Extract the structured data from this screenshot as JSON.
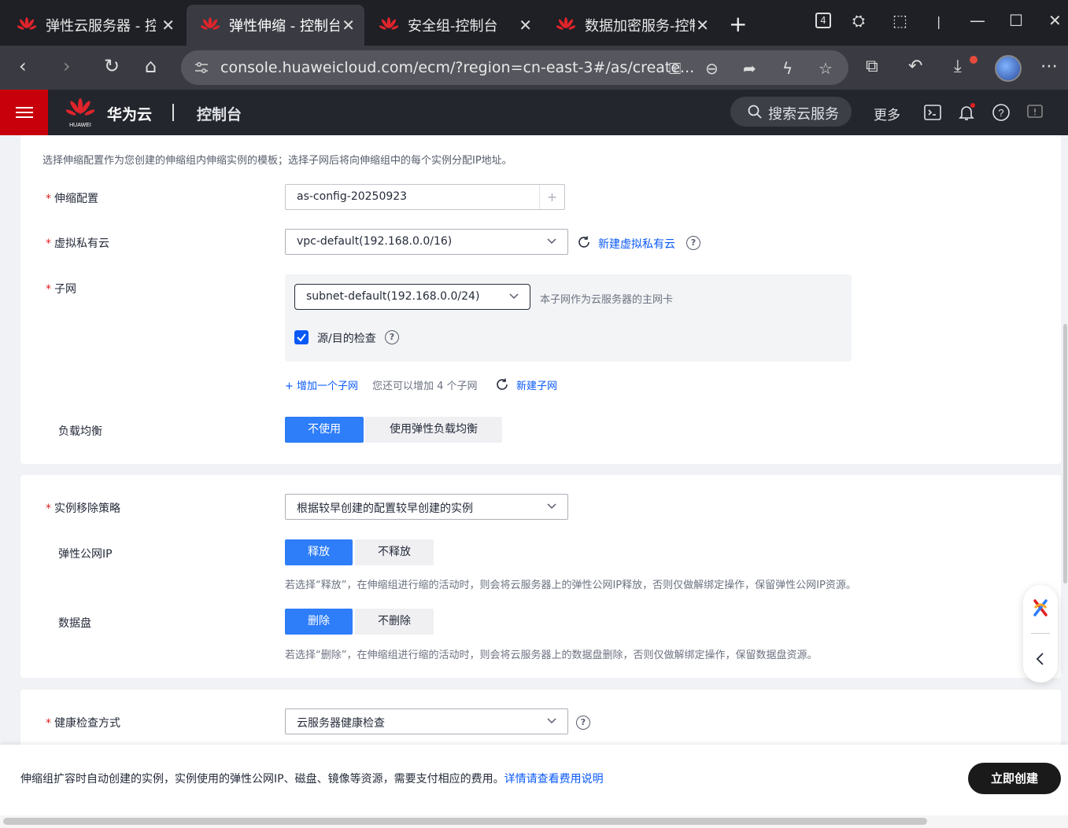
{
  "browser": {
    "tabs": [
      {
        "title": "弹性云服务器 - 控制台",
        "active": false
      },
      {
        "title": "弹性伸缩 - 控制台",
        "active": true
      },
      {
        "title": "安全组-控制台",
        "active": false
      },
      {
        "title": "数据加密服务-控制台",
        "active": false
      }
    ],
    "tab_count_badge": "4",
    "url": "console.huaweicloud.com/ecm/?region=cn-east-3#/as/create..."
  },
  "console_header": {
    "brand": "华为云",
    "logo_text": "HUAWEI",
    "console_label": "控制台",
    "search_placeholder": "搜索云服务",
    "more_label": "更多"
  },
  "section1": {
    "description": "选择伸缩配置作为您创建的伸缩组内伸缩实例的模板；选择子网后将向伸缩组中的每个实例分配IP地址。",
    "scaling_config": {
      "label": "伸缩配置",
      "value": "as-config-20250923",
      "add": "+"
    },
    "vpc": {
      "label": "虚拟私有云",
      "value": "vpc-default(192.168.0.0/16)",
      "create_link": "新建虚拟私有云"
    },
    "subnet": {
      "label": "子网",
      "value": "subnet-default(192.168.0.0/24)",
      "hint": "本子网作为云服务器的主网卡",
      "source_dest_check_label": "源/目的检查",
      "add_subnet_link": "+ 增加一个子网",
      "remaining_hint": "您还可以增加 4 个子网",
      "create_link": "新建子网"
    },
    "load_balance": {
      "label": "负载均衡",
      "options": [
        "不使用",
        "使用弹性负载均衡"
      ],
      "selected": "不使用"
    }
  },
  "section2": {
    "removal_policy": {
      "label": "实例移除策略",
      "value": "根据较早创建的配置较早创建的实例"
    },
    "eip": {
      "label": "弹性公网IP",
      "options": [
        "释放",
        "不释放"
      ],
      "selected": "释放",
      "hint": "若选择“释放”，在伸缩组进行缩的活动时，则会将云服务器上的弹性公网IP释放，否则仅做解绑定操作，保留弹性公网IP资源。"
    },
    "data_disk": {
      "label": "数据盘",
      "options": [
        "删除",
        "不删除"
      ],
      "selected": "删除",
      "hint": "若选择“删除”，在伸缩组进行缩的活动时，则会将云服务器上的数据盘删除，否则仅做解绑定操作，保留数据盘资源。"
    }
  },
  "section3": {
    "health_check": {
      "label": "健康检查方式",
      "value": "云服务器健康检查"
    }
  },
  "footer": {
    "note": "伸缩组扩容时自动创建的实例，实例使用的弹性公网IP、磁盘、镜像等资源，需要支付相应的费用。",
    "fee_link": "详情请查看费用说明",
    "create_button": "立即创建"
  },
  "colors": {
    "primary": "#2e7df9",
    "link": "#0a59f7",
    "huawei_red": "#c7000b",
    "required": "#e02020"
  }
}
